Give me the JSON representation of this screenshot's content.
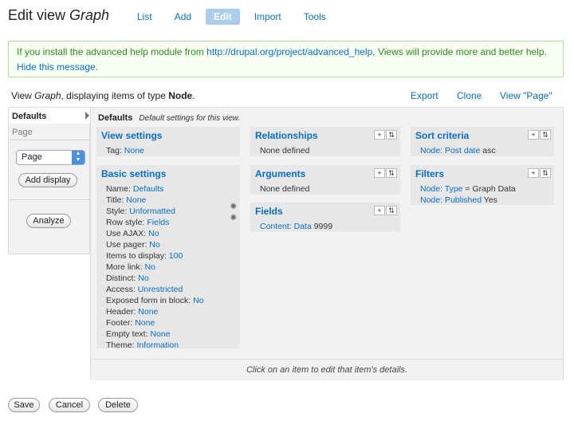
{
  "header": {
    "title_prefix": "Edit view ",
    "title_name": "Graph",
    "tabs": [
      {
        "label": "List",
        "active": false
      },
      {
        "label": "Add",
        "active": false
      },
      {
        "label": "Edit",
        "active": true
      },
      {
        "label": "Import",
        "active": false
      },
      {
        "label": "Tools",
        "active": false
      }
    ]
  },
  "message": {
    "text_before": "If you install the advanced help module from ",
    "link": "http://drupal.org/project/advanced_help",
    "text_after": ", Views will provide more and better help. ",
    "hide": "Hide this message."
  },
  "view_info": {
    "prefix": "View ",
    "name": "Graph",
    "middle": ", displaying items of type ",
    "type": "Node",
    "suffix": "."
  },
  "top_links": {
    "export": "Export",
    "clone": "Clone",
    "view_page": "View \"Page\""
  },
  "displays": {
    "active": "Defaults",
    "other": "Page",
    "select_value": "Page",
    "add_display": "Add display",
    "analyze": "Analyze"
  },
  "panel": {
    "title": "Defaults",
    "subtitle": "Default settings for this view."
  },
  "view_settings": {
    "title": "View settings",
    "tag_label": "Tag: ",
    "tag_value": "None"
  },
  "basic_settings": {
    "title": "Basic settings",
    "rows": [
      {
        "label": "Name: ",
        "value": "Defaults"
      },
      {
        "label": "Title: ",
        "value": "None"
      },
      {
        "label": "Style: ",
        "value": "Unformatted"
      },
      {
        "label": "Row style: ",
        "value": "Fields"
      },
      {
        "label": "Use AJAX: ",
        "value": "No"
      },
      {
        "label": "Use pager: ",
        "value": "No"
      },
      {
        "label": "Items to display: ",
        "value": "100"
      },
      {
        "label": "More link: ",
        "value": "No"
      },
      {
        "label": "Distinct: ",
        "value": "No"
      },
      {
        "label": "Access: ",
        "value": "Unrestricted"
      },
      {
        "label": "Exposed form in block: ",
        "value": "No"
      },
      {
        "label": "Header: ",
        "value": "None"
      },
      {
        "label": "Footer: ",
        "value": "None"
      },
      {
        "label": "Empty text: ",
        "value": "None"
      },
      {
        "label": "Theme: ",
        "value": "Information"
      }
    ]
  },
  "relationships": {
    "title": "Relationships",
    "empty": "None defined"
  },
  "arguments": {
    "title": "Arguments",
    "empty": "None defined"
  },
  "fields": {
    "title": "Fields",
    "item_link": "Content: Data",
    "item_extra": " 9999"
  },
  "sort_criteria": {
    "title": "Sort criteria",
    "item_link": "Node: Post date",
    "item_extra": " asc"
  },
  "filters": {
    "title": "Filters",
    "items": [
      {
        "link": "Node: Type",
        "extra": " = Graph Data"
      },
      {
        "link": "Node: Published",
        "extra": " Yes"
      }
    ]
  },
  "footer_hint": "Click on an item to edit that item's details.",
  "buttons": {
    "save": "Save",
    "cancel": "Cancel",
    "delete": "Delete"
  },
  "icon_glyphs": {
    "add": "+",
    "rearrange": "⇅",
    "gear": "✺"
  }
}
